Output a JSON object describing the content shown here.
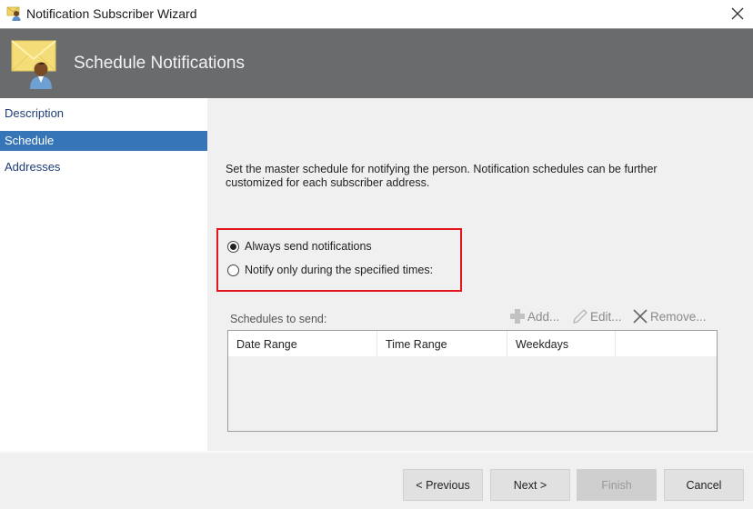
{
  "window": {
    "title": "Notification Subscriber Wizard",
    "app_icon": "subscriber-envelope-icon",
    "close_icon": "close-icon"
  },
  "header": {
    "title": "Schedule Notifications",
    "icon": "envelope-person-icon"
  },
  "sidebar": {
    "items": [
      {
        "label": "Description",
        "active": false
      },
      {
        "label": "Schedule",
        "active": true
      },
      {
        "label": "Addresses",
        "active": false
      }
    ]
  },
  "main": {
    "description": "Set the master schedule for notifying the person. Notification schedules can be further customized for each subscriber address.",
    "options": [
      {
        "label": "Always send notifications",
        "selected": true
      },
      {
        "label": "Notify only during the specified times:",
        "selected": false
      }
    ],
    "schedules_label": "Schedules to send:",
    "toolbar": {
      "add": "Add...",
      "edit": "Edit...",
      "remove": "Remove..."
    },
    "table": {
      "columns": [
        "Date Range",
        "Time Range",
        "Weekdays",
        ""
      ],
      "rows": []
    }
  },
  "footer": {
    "previous": "< Previous",
    "next": "Next >",
    "finish": "Finish",
    "cancel": "Cancel"
  },
  "colors": {
    "header_bg": "#696b6d",
    "active_nav": "#3575b8",
    "highlight_border": "#e3161d"
  }
}
